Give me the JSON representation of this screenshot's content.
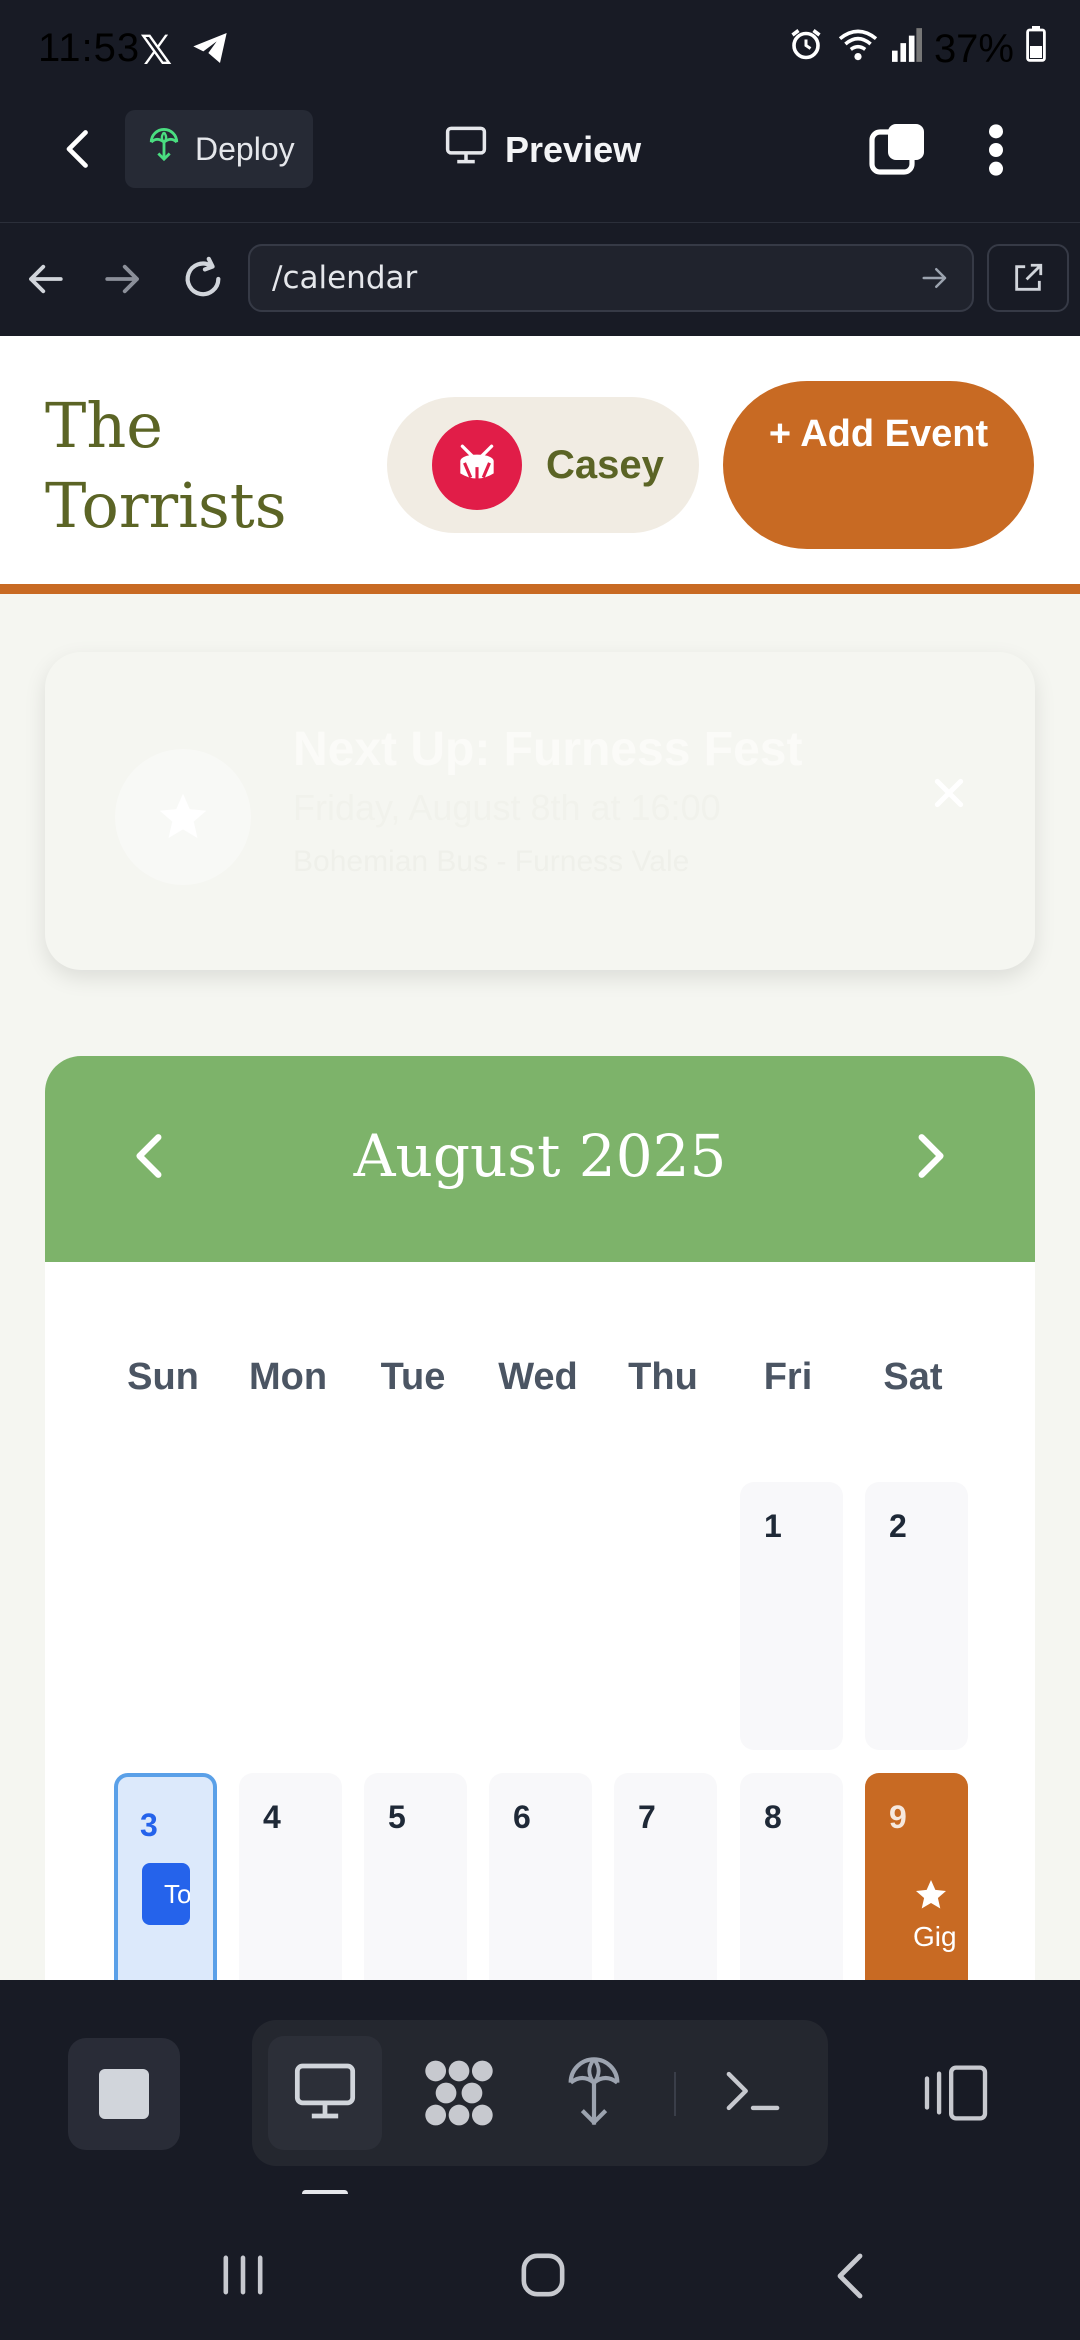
{
  "status_bar": {
    "time": "11:53",
    "battery": "37%"
  },
  "app_header": {
    "deploy_label": "Deploy",
    "preview_label": "Preview"
  },
  "url_bar": {
    "url": "/calendar"
  },
  "site": {
    "title": "The Torrists",
    "user_name": "Casey",
    "add_event_label": "+ Add Event"
  },
  "next_up": {
    "title": "Next Up: Furness Fest",
    "datetime": "Friday, August 8th at 16:00",
    "venue": "Bohemian Bus - Furness Vale"
  },
  "calendar": {
    "month_label": "August 2025",
    "weekdays": [
      "Sun",
      "Mon",
      "Tue",
      "Wed",
      "Thu",
      "Fri",
      "Sat"
    ],
    "days": [
      "1",
      "2",
      "3",
      "4",
      "5",
      "6",
      "7",
      "8",
      "9"
    ],
    "today_badge": "Today",
    "gig_label": "Gig"
  },
  "colors": {
    "accent_orange": "#c86a23",
    "calendar_green": "#7db36a",
    "title_olive": "#5b6425",
    "today_blue": "#2563eb"
  }
}
